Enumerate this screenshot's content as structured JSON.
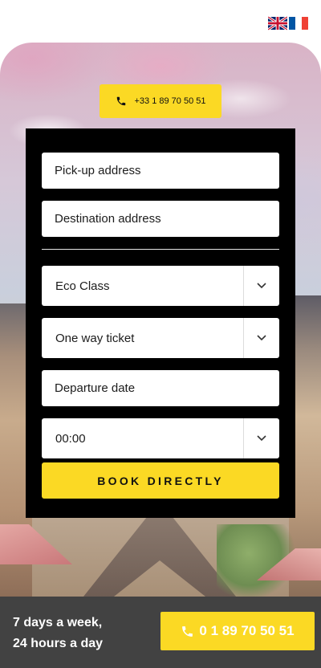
{
  "header": {
    "languages": [
      {
        "code": "en",
        "icon": "uk-flag-icon"
      },
      {
        "code": "fr",
        "icon": "france-flag-icon"
      }
    ]
  },
  "hero": {
    "phone": "+33 1 89 70 50 51",
    "phone_icon": "phone-icon"
  },
  "booking_form": {
    "pickup_placeholder": "Pick-up address",
    "destination_placeholder": "Destination address",
    "vehicle_class": "Eco Class",
    "ticket_type": "One way ticket",
    "departure_date_placeholder": "Departure date",
    "departure_time": "00:00",
    "submit_label": "BOOK DIRECTLY"
  },
  "footer": {
    "availability_line1": "7 days a week,",
    "availability_line2": "24 hours a day",
    "call_label": "0 1 89 70 50 51",
    "call_icon": "phone-icon"
  },
  "colors": {
    "accent": "#fbd924",
    "form_bg": "#000000",
    "footer_bg": "#424242"
  }
}
